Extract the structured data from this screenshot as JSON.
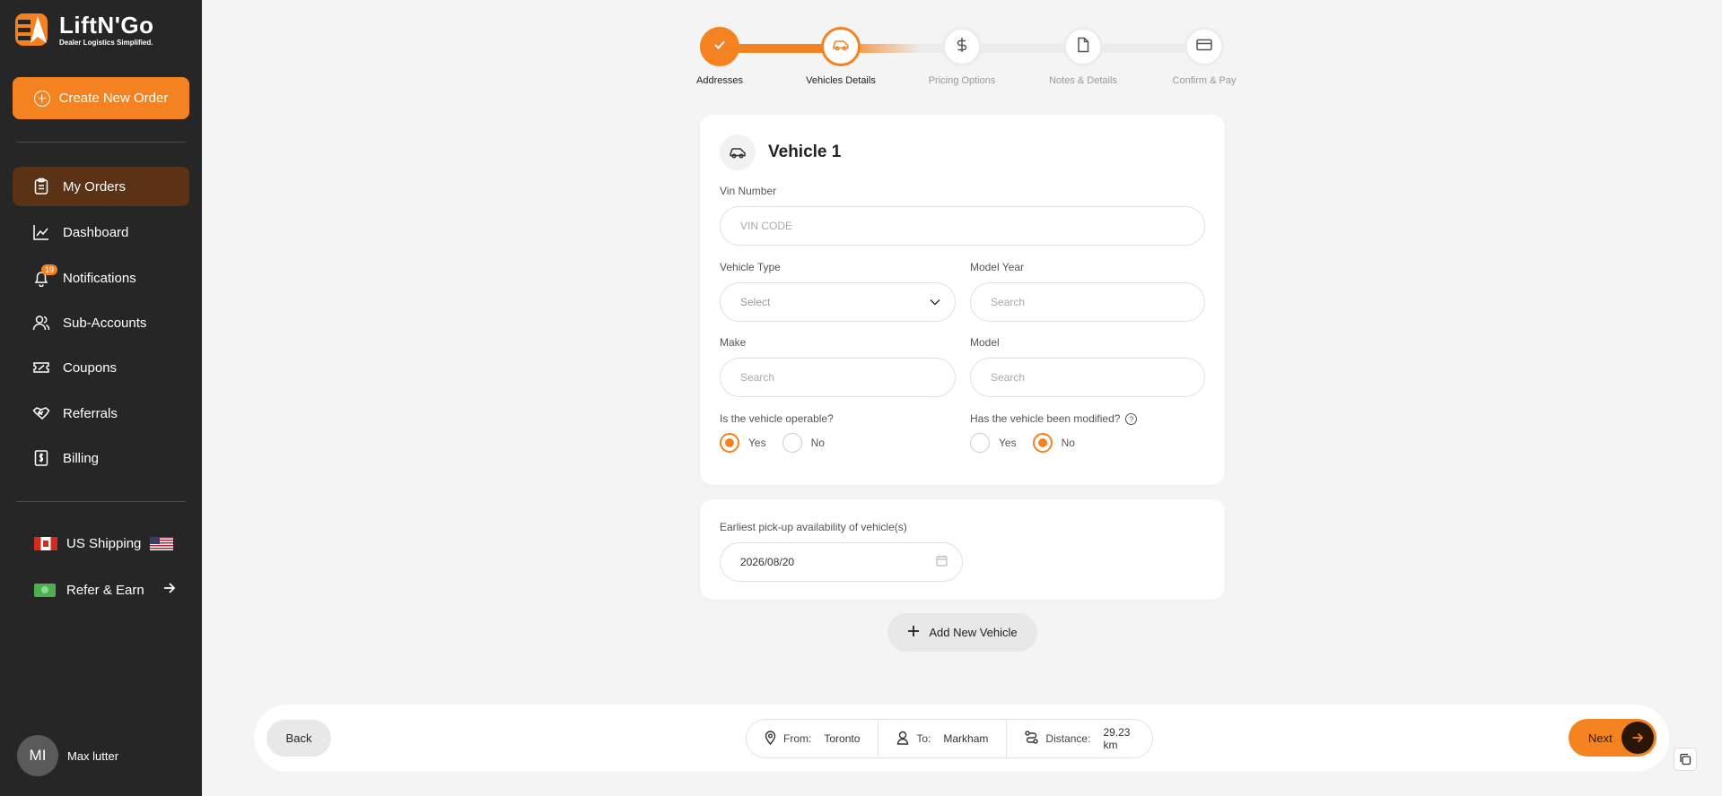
{
  "brand": {
    "name": "LiftN'Go",
    "tagline": "Dealer Logistics Simplified."
  },
  "sidebar": {
    "create_label": "Create New Order",
    "items": [
      {
        "label": "My Orders",
        "icon": "clipboard-icon",
        "active": true
      },
      {
        "label": "Dashboard",
        "icon": "chart-icon"
      },
      {
        "label": "Notifications",
        "icon": "bell-icon",
        "badge": "19"
      },
      {
        "label": "Sub-Accounts",
        "icon": "users-icon"
      },
      {
        "label": "Coupons",
        "icon": "ticket-icon"
      },
      {
        "label": "Referrals",
        "icon": "handshake-icon"
      },
      {
        "label": "Billing",
        "icon": "receipt-icon"
      }
    ],
    "shipping_label": "US Shipping",
    "refer_label": "Refer & Earn",
    "user": {
      "initials": "MI",
      "name": "Max lutter"
    }
  },
  "stepper": {
    "steps": [
      {
        "label": "Addresses",
        "state": "done"
      },
      {
        "label": "Vehicles Details",
        "state": "current"
      },
      {
        "label": "Pricing Options",
        "state": "pending"
      },
      {
        "label": "Notes & Details",
        "state": "pending"
      },
      {
        "label": "Confirm & Pay",
        "state": "pending"
      }
    ]
  },
  "vehicle": {
    "title": "Vehicle 1",
    "vin_label": "Vin Number",
    "vin_placeholder": "VIN CODE",
    "type_label": "Vehicle Type",
    "type_value": "Select",
    "year_label": "Model Year",
    "year_placeholder": "Search",
    "make_label": "Make",
    "make_placeholder": "Search",
    "model_label": "Model",
    "model_placeholder": "Search",
    "operable_label": "Is the vehicle operable?",
    "modified_label": "Has the vehicle been modified?",
    "yes": "Yes",
    "no": "No",
    "operable": "Yes",
    "modified": "No"
  },
  "pickup": {
    "label": "Earliest pick-up availability of vehicle(s)",
    "date": "2026/08/20"
  },
  "add_vehicle_label": "Add New Vehicle",
  "footer": {
    "back": "Back",
    "from_label": "From:",
    "from": "Toronto",
    "to_label": "To:",
    "to": "Markham",
    "distance_label": "Distance:",
    "distance": "29.23 km",
    "next": "Next"
  },
  "colors": {
    "accent": "#f58220",
    "sidebar": "#262626",
    "active_item": "#5a3215",
    "background": "#f4f4f4"
  }
}
